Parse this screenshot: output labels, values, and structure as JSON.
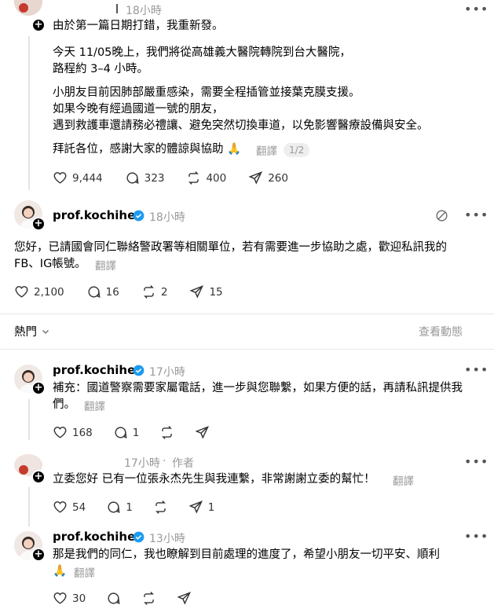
{
  "post_top": {
    "time": "18小時",
    "lines": [
      "由於第一篇日期打錯，我重新發。",
      "今天 11/05晚上，我們將從高雄義大醫院轉院到台大醫院，",
      "路程約 3–4 小時。",
      "小朋友目前因肺部嚴重感染，需要全程插管並接葉克膜支援。",
      "如果今晚有經過國道一號的朋友，",
      "遇到救護車還請務必禮讓、避免突然切換車道，以免影響醫療設備與安全。",
      "拜託各位，感謝大家的體諒與協助 🙏"
    ],
    "translate": "翻譯",
    "page_badge": "1/2",
    "likes": "9,444",
    "comments": "323",
    "reposts": "400",
    "shares": "260"
  },
  "reply_main": {
    "username": "prof.kochihen",
    "time": "18小時",
    "line1": "您好，已請國會同仁聯絡警政署等相關單位，若有需要進一步協助之處，歡迎私訊我的",
    "line2": "FB、IG帳號。",
    "translate": "翻譯",
    "likes": "2,100",
    "comments": "16",
    "reposts": "2",
    "shares": "15"
  },
  "sort_bar": {
    "label": "熱門",
    "activity": "查看動態"
  },
  "reply_1": {
    "username": "prof.kochihen",
    "time": "17小時",
    "line1": "補充：國道警察需要家屬電話，進一步與您聯繫，如果方便的話，再請私訊提供我",
    "line2": "們。",
    "translate": "翻譯",
    "likes": "168",
    "comments": "1"
  },
  "reply_2": {
    "time": "17小時",
    "author_tag": "作者",
    "line1": "立委您好 已有一位張永杰先生與我連繫，非常謝謝立委的幫忙！",
    "translate": "翻譯",
    "likes": "54",
    "comments": "1",
    "shares": "1"
  },
  "reply_3": {
    "username": "prof.kochihen",
    "time": "13小時",
    "line1": "那是我們的同仁，我也瞭解到目前處理的進度了，希望小朋友一切平安、順利",
    "line2": "🙏",
    "translate": "翻譯",
    "likes": "30"
  },
  "colors": {
    "verified": "#1d9bf0",
    "muted": "#999999",
    "divider": "#e8e8e8"
  }
}
